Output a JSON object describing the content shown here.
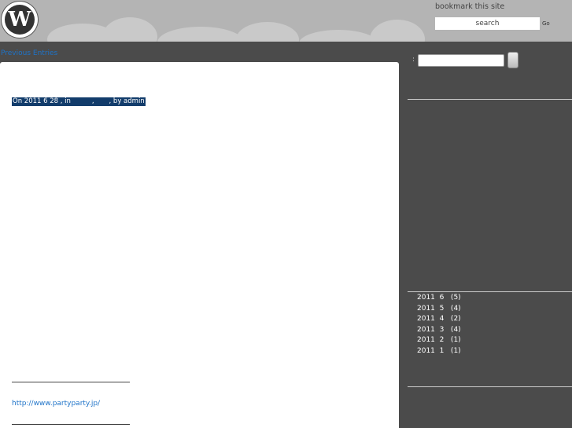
{
  "header": {
    "bookmark_label": "bookmark this site",
    "search_value": "search",
    "go_label": "Go"
  },
  "nav": {
    "previous_entries": "Previous Entries"
  },
  "post": {
    "meta_text": "On 2011 6 28 , in          ,       , by admin",
    "link_text": "http://www.partyparty.jp/"
  },
  "sidebar": {
    "search_colon": ":",
    "archives": [
      {
        "label": "2011  6   (5)"
      },
      {
        "label": "2011  5   (4)"
      },
      {
        "label": "2011  4   (2)"
      },
      {
        "label": "2011  3   (4)"
      },
      {
        "label": "2011  2   (1)"
      },
      {
        "label": "2011  1   (1)"
      }
    ]
  },
  "colors": {
    "header_bg": "#b4b4b4",
    "page_bg": "#4b4b4b",
    "link": "#1e73c8",
    "meta_highlight": "#123c6b"
  },
  "icons": {
    "logo": "wordpress-logo-icon"
  }
}
